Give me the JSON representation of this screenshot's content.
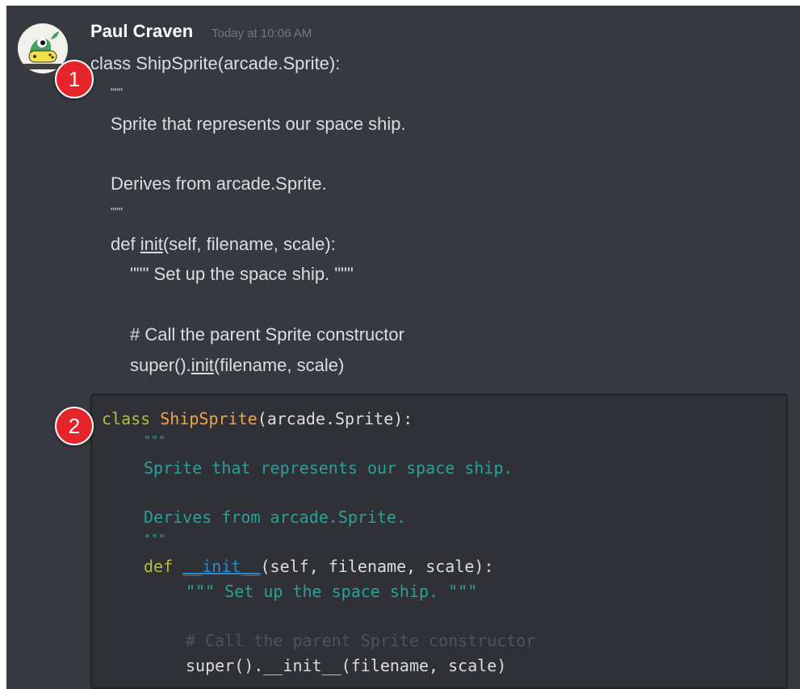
{
  "message": {
    "author": "Paul Craven",
    "timestamp": "Today at 10:06 AM",
    "text_lines": {
      "l1": "class ShipSprite(arcade.Sprite):",
      "l2": "\"\"\"",
      "l3": "Sprite that represents our space ship.",
      "l4": "Derives from arcade.Sprite.",
      "l5": "\"\"\"",
      "l6_a": "def ",
      "l6_b": "init",
      "l6_c": "(self, filename, scale):",
      "l7": "\"\"\" Set up the space ship. \"\"\"",
      "l8": "# Call the parent Sprite constructor",
      "l9_a": "super().",
      "l9_b": "init",
      "l9_c": "(filename, scale)"
    }
  },
  "code_block": {
    "language": "python",
    "lines": {
      "c1_kw": "class",
      "c1_cls": "ShipSprite",
      "c1_rest": "(arcade.Sprite):",
      "c2": "\"\"\"",
      "c3": "Sprite that represents our space ship.",
      "c4": "Derives from arcade.Sprite.",
      "c5": "\"\"\"",
      "c6_kw": "def",
      "c6_fn": "__init__",
      "c6_rest": "(self, filename, scale):",
      "c7": "\"\"\" Set up the space ship. \"\"\"",
      "c8": "# Call the parent Sprite constructor",
      "c9": "super().__init__(filename, scale)"
    }
  },
  "badges": {
    "one": "1",
    "two": "2"
  },
  "colors": {
    "background": "#36393f",
    "code_background": "#2f3136",
    "keyword": "#b5bd3a",
    "class_name": "#f0a34a",
    "docstring": "#2aa198",
    "function": "#268bd2",
    "comment": "#4f5258",
    "badge": "#e5252a"
  },
  "icons": {
    "avatar": "python-arcade-avatar-icon"
  }
}
